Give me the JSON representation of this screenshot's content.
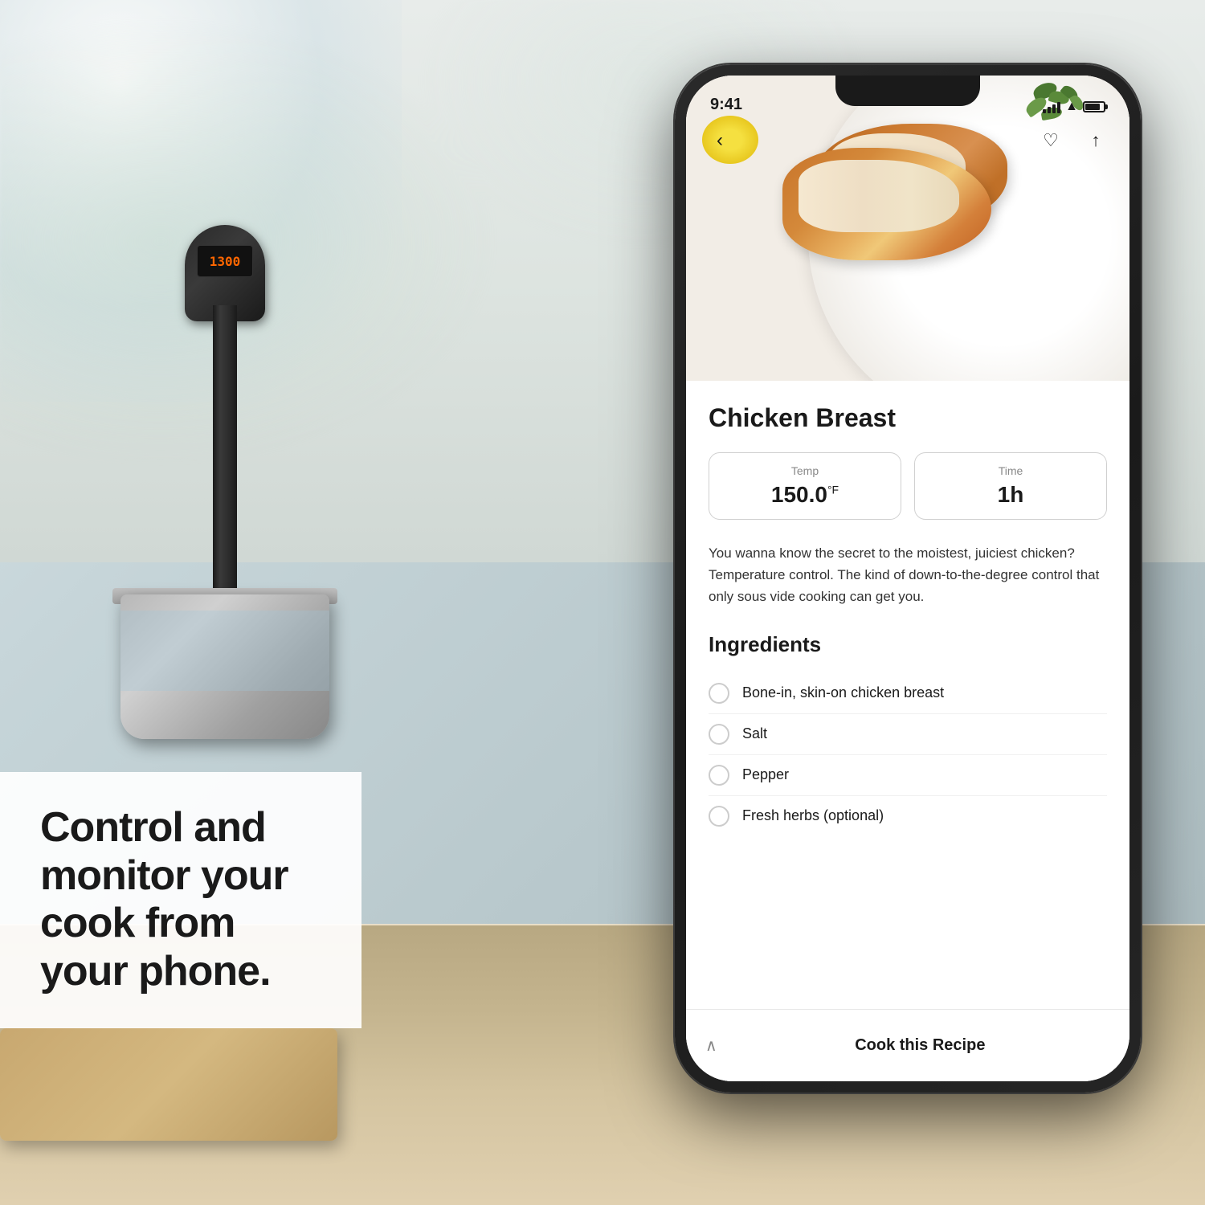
{
  "background": {
    "colors": {
      "wall": "#d5e0de",
      "counter": "#c8b882"
    }
  },
  "sous_vide": {
    "display_text": "1300"
  },
  "text_overlay": {
    "headline": "Control and monitor your cook from your phone."
  },
  "phone": {
    "status_bar": {
      "time": "9:41"
    },
    "nav": {
      "back_icon": "‹",
      "heart_icon": "♡",
      "share_icon": "↑"
    },
    "recipe": {
      "title": "Chicken Breast",
      "temp_label": "Temp",
      "temp_value": "150.0",
      "temp_unit": "°F",
      "time_label": "Time",
      "time_value": "1h",
      "description": "You wanna know the secret to the moistest, juiciest chicken? Temperature control. The kind of down-to-the-degree control that only sous vide cooking can get you.",
      "ingredients_title": "Ingredients",
      "ingredients": [
        "Bone-in, skin-on chicken breast",
        "Salt",
        "Pepper",
        "Fresh herbs (optional)"
      ]
    },
    "cook_bar": {
      "chevron": "∧",
      "label": "Cook this Recipe"
    }
  }
}
